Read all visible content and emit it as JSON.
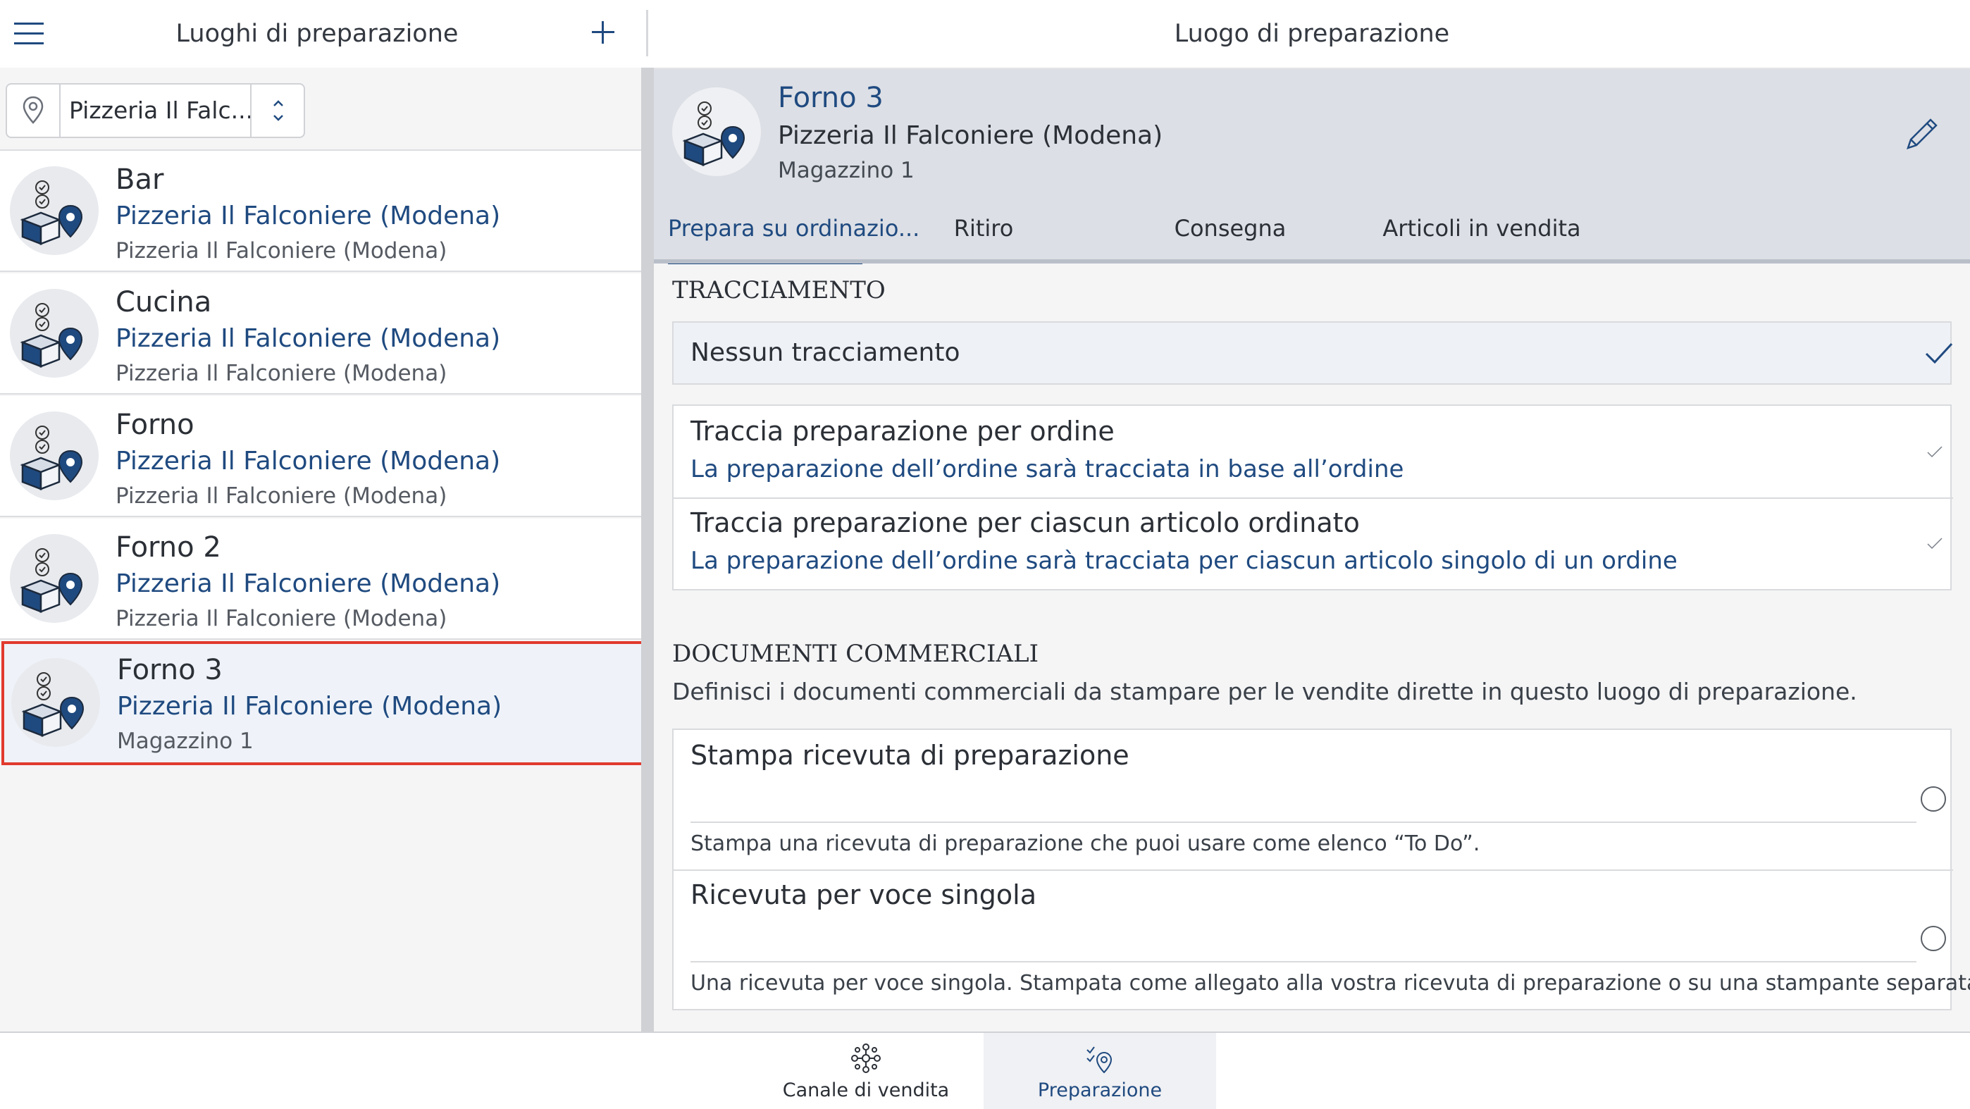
{
  "left_panel": {
    "title": "Luoghi di preparazione",
    "location_filter": {
      "value": "Pizzeria Il Falc..."
    },
    "items": [
      {
        "name": "Bar",
        "subtitle": "Pizzeria Il Falconiere (Modena)",
        "detail": "Pizzeria Il Falconiere (Modena)"
      },
      {
        "name": "Cucina",
        "subtitle": "Pizzeria Il Falconiere (Modena)",
        "detail": "Pizzeria Il Falconiere (Modena)"
      },
      {
        "name": "Forno",
        "subtitle": "Pizzeria Il Falconiere (Modena)",
        "detail": "Pizzeria Il Falconiere (Modena)"
      },
      {
        "name": "Forno 2",
        "subtitle": "Pizzeria Il Falconiere (Modena)",
        "detail": "Pizzeria Il Falconiere (Modena)"
      },
      {
        "name": "Forno 3",
        "subtitle": "Pizzeria Il Falconiere (Modena)",
        "detail": "Magazzino 1",
        "selected": true
      }
    ]
  },
  "right_panel": {
    "title": "Luogo di preparazione",
    "detail": {
      "name": "Forno 3",
      "subtitle": "Pizzeria Il Falconiere (Modena)",
      "detail": "Magazzino 1"
    },
    "tabs": [
      {
        "label": "Prepara su ordinazio...",
        "active": true
      },
      {
        "label": "Ritiro"
      },
      {
        "label": "Consegna"
      },
      {
        "label": "Articoli in vendita"
      }
    ],
    "tracking": {
      "title": "TRACCIAMENTO",
      "options": [
        {
          "title": "Nessun tracciamento",
          "selected": true
        },
        {
          "title": "Traccia preparazione per ordine",
          "description": "La preparazione dell’ordine sarà tracciata in base all’ordine"
        },
        {
          "title": "Traccia preparazione per ciascun articolo ordinato",
          "description": "La preparazione dell’ordine sarà tracciata per ciascun articolo singolo di un ordine"
        }
      ]
    },
    "documents": {
      "title": "DOCUMENTI COMMERCIALI",
      "description": "Definisci i documenti commerciali da stampare per le vendite dirette in questo luogo di preparazione.",
      "options": [
        {
          "title": "Stampa ricevuta di preparazione",
          "description": "Stampa una ricevuta di preparazione che puoi usare come elenco “To Do”."
        },
        {
          "title": "Ricevuta per voce singola",
          "description": "Una ricevuta per voce singola. Stampata come allegato alla vostra ricevuta di preparazione o su una stampante separata."
        }
      ]
    }
  },
  "bottom_bar": {
    "tabs": [
      {
        "label": "Canale di vendita",
        "icon": "sales-channel-icon"
      },
      {
        "label": "Preparazione",
        "icon": "preparation-icon",
        "active": true
      }
    ]
  },
  "colors": {
    "accent": "#1f4a80",
    "selection_border": "#e23a2f",
    "header_grey": "#dcdfe5"
  }
}
